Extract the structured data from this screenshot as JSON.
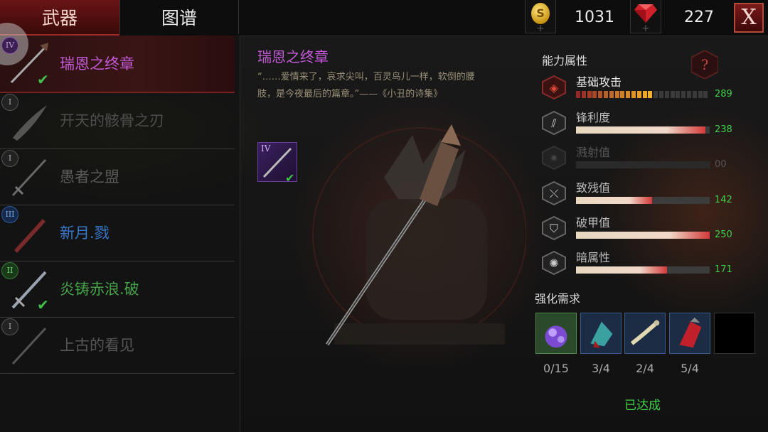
{
  "tabs": {
    "weapons": "武器",
    "codex": "图谱"
  },
  "currency": {
    "coins": "1031",
    "coin_glyph": "S",
    "gems": "227",
    "coin_icon": "coin-icon",
    "gem_icon": "ruby-gem-icon"
  },
  "close_label": "X",
  "weapon_list": [
    {
      "name": "瑞恩之终章",
      "rank": "IV",
      "color": "#c25ad6",
      "selected": true,
      "owned": true
    },
    {
      "name": "开天的骸骨之刃",
      "rank": "I",
      "color": "#4d4d4d",
      "owned": false
    },
    {
      "name": "愚者之盟",
      "rank": "I",
      "color": "#5a5a5a",
      "owned": false
    },
    {
      "name": "新月.戮",
      "rank": "III",
      "color": "#3a78c8",
      "owned": false
    },
    {
      "name": "炎铸赤浪.破",
      "rank": "II",
      "color": "#47a24a",
      "owned": true
    },
    {
      "name": "上古的看见",
      "rank": "I",
      "color": "#555555",
      "owned": false
    }
  ],
  "detail": {
    "title": "瑞恩之终章",
    "quote": "“……爱情来了，哀求尖叫，百灵鸟儿一样，软倒的腰肢，是今夜最后的篇章。”——《小丑的诗集》",
    "rank": "IV"
  },
  "stats": {
    "heading": "能力属性",
    "help_label": "?",
    "items": [
      {
        "label": "基础攻击",
        "value": "289",
        "fill": 0.57,
        "icon": "base-attack-icon",
        "segmented": true
      },
      {
        "label": "锋利度",
        "value": "238",
        "fill": 0.97,
        "icon": "sharpness-icon"
      },
      {
        "label": "溅射值",
        "value": "00",
        "fill": 0,
        "icon": "splash-icon",
        "dim": true
      },
      {
        "label": "致残值",
        "value": "142",
        "fill": 0.57,
        "icon": "cripple-icon"
      },
      {
        "label": "破甲值",
        "value": "250",
        "fill": 1.0,
        "icon": "armor-break-icon"
      },
      {
        "label": "暗属性",
        "value": "171",
        "fill": 0.68,
        "icon": "dark-attribute-icon"
      }
    ]
  },
  "upgrade": {
    "heading": "强化需求",
    "materials": [
      {
        "count": "0/15",
        "icon": "purple-crystal-icon",
        "bg": "#2b4a2b",
        "border": "#4f8a4a"
      },
      {
        "count": "3/4",
        "icon": "teal-shard-icon",
        "bg": "#1c2c44",
        "border": "#3a5a8a"
      },
      {
        "count": "2/4",
        "icon": "bone-claw-icon",
        "bg": "#1c2c44",
        "border": "#3a5a8a"
      },
      {
        "count": "5/4",
        "icon": "red-gauntlet-icon",
        "bg": "#1c2c44",
        "border": "#3a5a8a"
      },
      {
        "count": "",
        "icon": "empty-slot",
        "bg": "#000000",
        "border": "#333333"
      }
    ],
    "status": "已达成"
  },
  "colors": {
    "accent_red": "#7a1f1f",
    "rare_purple": "#c25ad6",
    "ok_green": "#40d04a"
  }
}
